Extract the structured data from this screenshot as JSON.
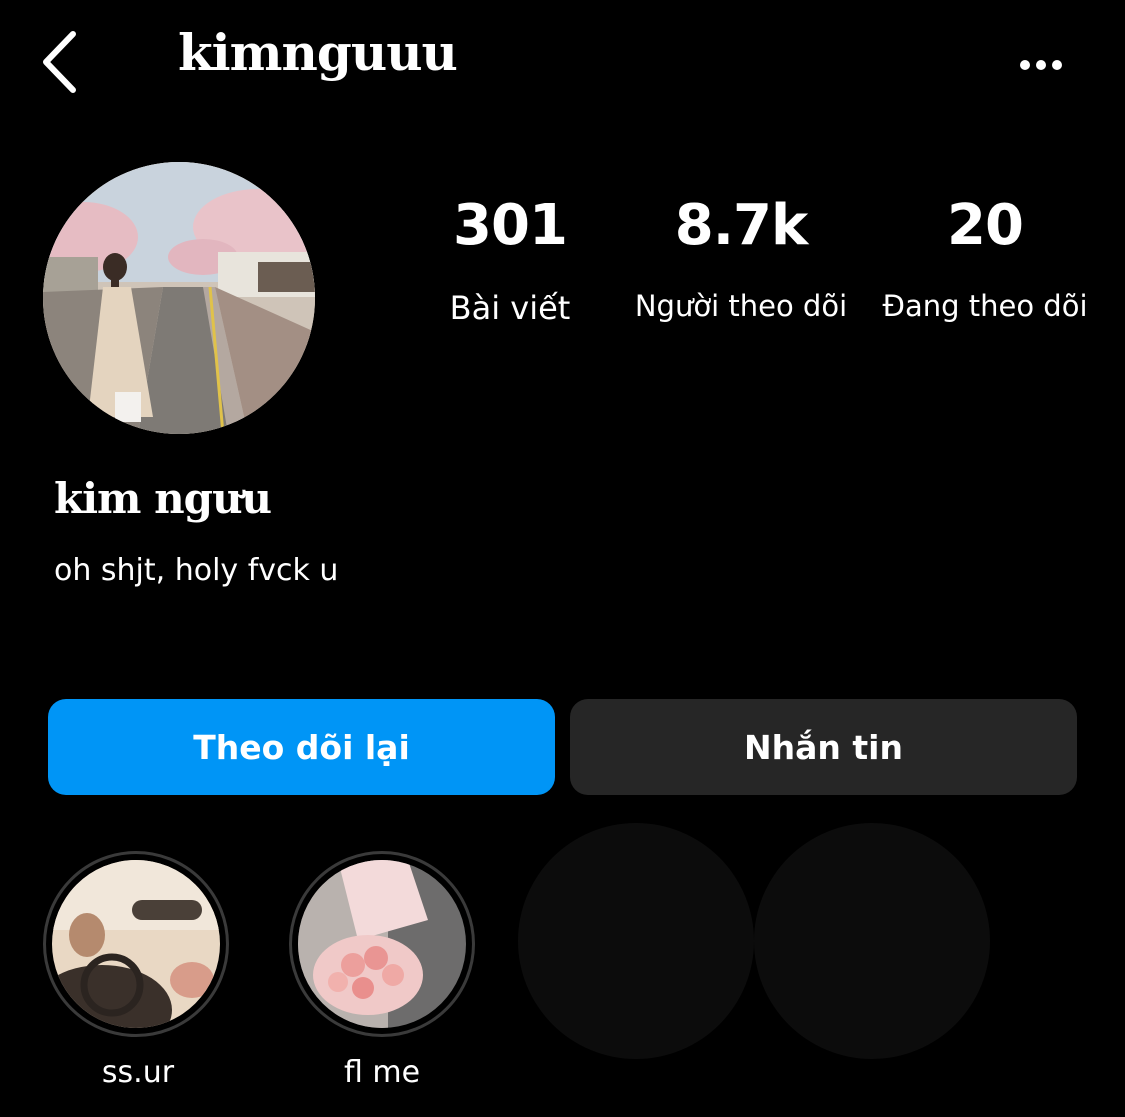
{
  "header": {
    "username": "kimnguuu"
  },
  "stats": {
    "posts": {
      "value": "301",
      "label": "Bài viết"
    },
    "followers": {
      "value": "8.7k",
      "label": "Người theo dõi"
    },
    "following": {
      "value": "20",
      "label": "Đang theo dõi"
    }
  },
  "profile": {
    "display_name": "kim ngưu",
    "bio": "oh shjt, holy fvck u"
  },
  "actions": {
    "follow_back_label": "Theo dõi lại",
    "message_label": "Nhắn tin"
  },
  "highlights": [
    {
      "label": "ss.ur"
    },
    {
      "label": "fl me"
    }
  ],
  "colors": {
    "accent": "#0095f6",
    "secondary_button": "#262626",
    "background": "#000000"
  },
  "icons": [
    "chevron-left-icon",
    "more-horizontal-icon"
  ]
}
